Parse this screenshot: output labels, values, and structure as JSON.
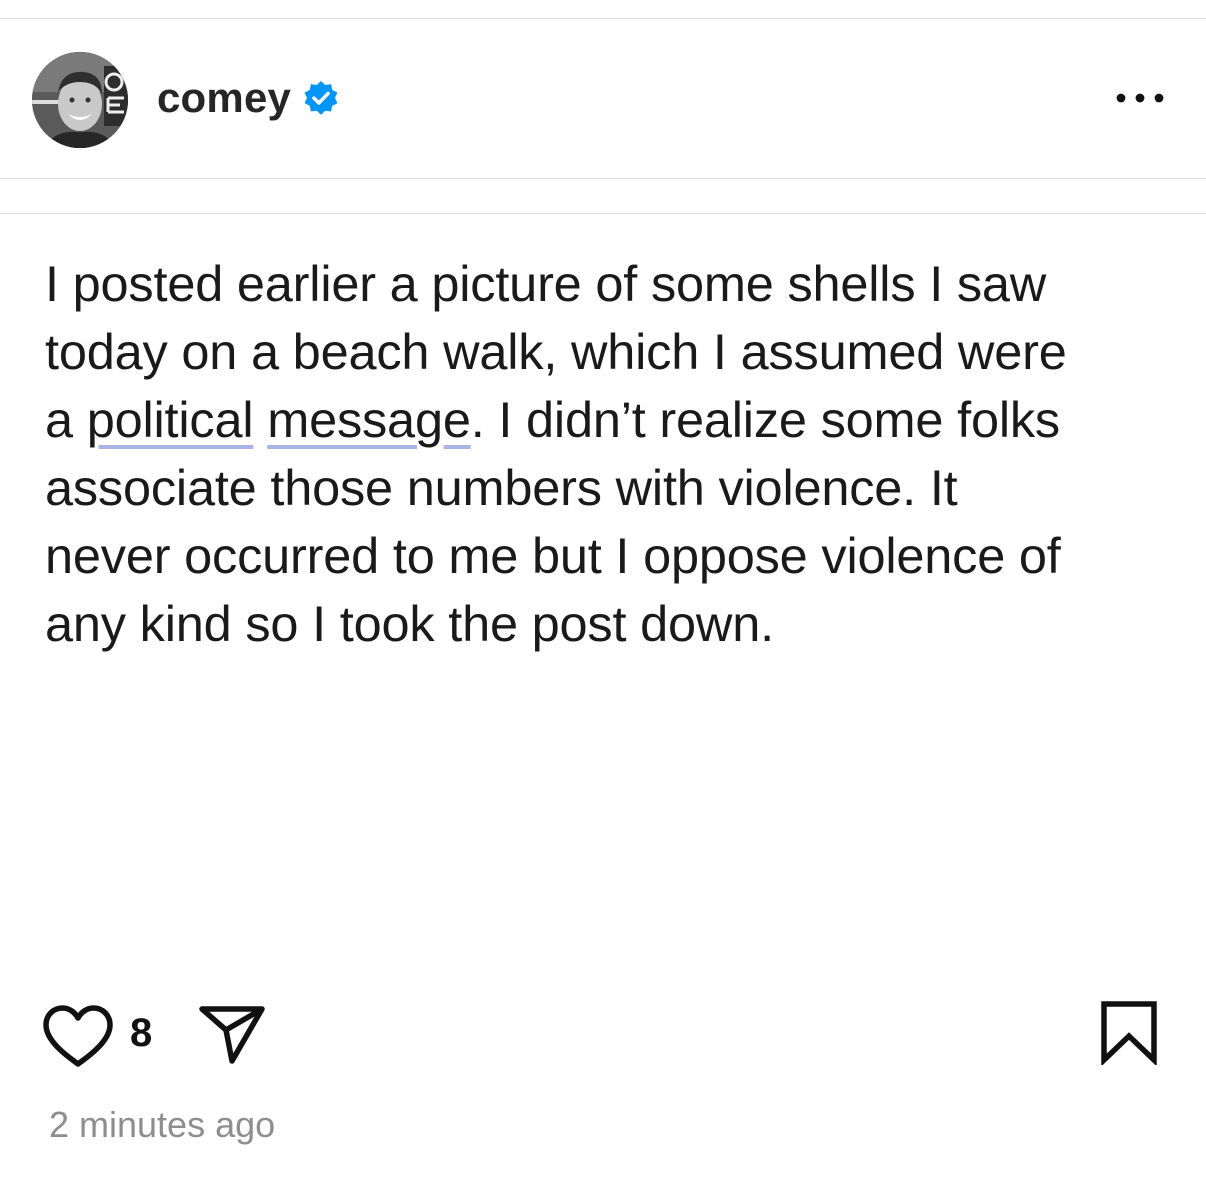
{
  "post": {
    "author": {
      "username": "comey",
      "verified": true,
      "avatar_icon": "profile-photo",
      "verified_icon": "verified-badge-icon",
      "badge_color": "#0095F6"
    },
    "more_icon": "more-options-icon",
    "text_lines": [
      "I posted earlier a picture of some shells I saw",
      "today on a beach walk, which I assumed were",
      "a",
      "political",
      "message",
      ". I didn’t realize some folks",
      "associate those numbers with violence. It",
      "never occurred to me but I oppose violence of",
      "any kind so I took the post down."
    ],
    "like_count": "8",
    "timestamp": "2 minutes ago",
    "icons": {
      "like": "heart-icon",
      "share": "send-icon",
      "save": "bookmark-icon"
    }
  }
}
